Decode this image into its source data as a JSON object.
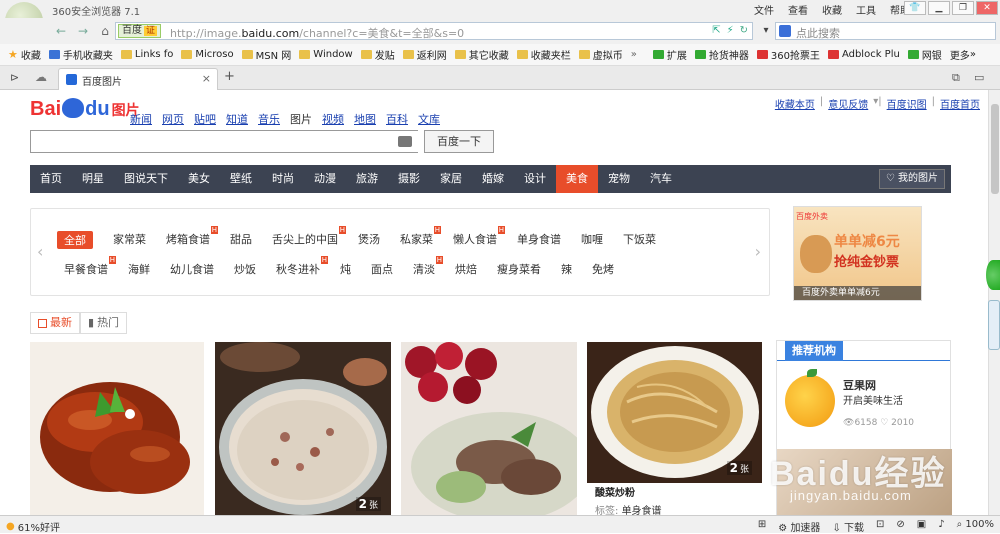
{
  "browser": {
    "title": "360安全浏览器 7.1",
    "menus": [
      "文件",
      "查看",
      "收藏",
      "工具",
      "帮助"
    ],
    "nav_back": "←",
    "nav_forward": "→",
    "nav_home": "⌂",
    "engine_label": "百度",
    "engine_tag": "证",
    "url_prefix": "http://image.",
    "url_domain": "baidu.com",
    "url_rest": "/channel?c=美食&t=全部&s=0",
    "search_placeholder": "点此搜索"
  },
  "bookmarks_left": [
    "收藏",
    "手机收藏夹",
    "Links fo",
    "Microso",
    "MSN 网",
    "Window",
    "发贴",
    "返利网",
    "其它收藏",
    "收藏夹栏",
    "虚拟币"
  ],
  "bookmarks_right": [
    "扩展",
    "抢货神器",
    "360抢票王",
    "Adblock Plu",
    "网银",
    "更多"
  ],
  "tab": {
    "label": "百度图片",
    "close": "×",
    "new": "+"
  },
  "page": {
    "logo_bai": "Bai",
    "logo_du": "du",
    "logo_pic": "图片",
    "channel_nav": [
      "新闻",
      "网页",
      "贴吧",
      "知道",
      "音乐",
      "图片",
      "视频",
      "地图",
      "百科",
      "文库"
    ],
    "top_links": [
      "收藏本页",
      "意见反馈",
      "百度识图",
      "百度首页"
    ],
    "search_button": "百度一下",
    "categories": [
      "首页",
      "明星",
      "图说天下",
      "美女",
      "壁纸",
      "时尚",
      "动漫",
      "旅游",
      "摄影",
      "家居",
      "婚嫁",
      "设计",
      "美食",
      "宠物",
      "汽车"
    ],
    "active_category": "美食",
    "my_images": "我的图片",
    "tags_row1": [
      {
        "t": "全部",
        "h": false
      },
      {
        "t": "家常菜",
        "h": false
      },
      {
        "t": "烤箱食谱",
        "h": true
      },
      {
        "t": "甜品",
        "h": false
      },
      {
        "t": "舌尖上的中国",
        "h": true
      },
      {
        "t": "煲汤",
        "h": false
      },
      {
        "t": "私家菜",
        "h": true
      },
      {
        "t": "懒人食谱",
        "h": true
      },
      {
        "t": "单身食谱",
        "h": false
      },
      {
        "t": "咖喱",
        "h": false
      },
      {
        "t": "下饭菜",
        "h": false
      }
    ],
    "tags_row2": [
      {
        "t": "早餐食谱",
        "h": true
      },
      {
        "t": "海鲜",
        "h": false
      },
      {
        "t": "幼儿食谱",
        "h": false
      },
      {
        "t": "炒饭",
        "h": false
      },
      {
        "t": "秋冬进补",
        "h": true
      },
      {
        "t": "炖",
        "h": false
      },
      {
        "t": "面点",
        "h": false
      },
      {
        "t": "清淡",
        "h": true
      },
      {
        "t": "烘焙",
        "h": false
      },
      {
        "t": "瘦身菜肴",
        "h": false
      },
      {
        "t": "辣",
        "h": false
      },
      {
        "t": "免烤",
        "h": false
      }
    ],
    "ad": {
      "top": "百度外卖",
      "l1": "单单减6元",
      "l2": "抢纯金钞票",
      "caption": "百度外卖单单减6元"
    },
    "sort_tabs": [
      "最新",
      "热门"
    ],
    "photos": [
      {
        "count": "",
        "unit": ""
      },
      {
        "count": "2",
        "unit": "张"
      },
      {
        "count": "",
        "unit": ""
      },
      {
        "count": "2",
        "unit": "张"
      }
    ],
    "photo4_title": "酸菜炒粉",
    "photo4_tag_label": "标签:",
    "photo4_tag": "单身食谱",
    "recommend": {
      "header": "推荐机构",
      "name": "豆果网",
      "desc": "开启美味生活",
      "stats": "6158 ♡ 2010"
    },
    "watermark": "Baidu经验",
    "watermark_url": "jingyan.baidu.com"
  },
  "status": {
    "left": "61%好评",
    "speed": "加速器",
    "download": "下载",
    "zoom": "100%"
  },
  "colors": {
    "accent": "#e84d2a",
    "nav": "#3c4352",
    "link": "#1a40b0",
    "baidu_red": "#e33",
    "baidu_blue": "#2e66d8"
  }
}
